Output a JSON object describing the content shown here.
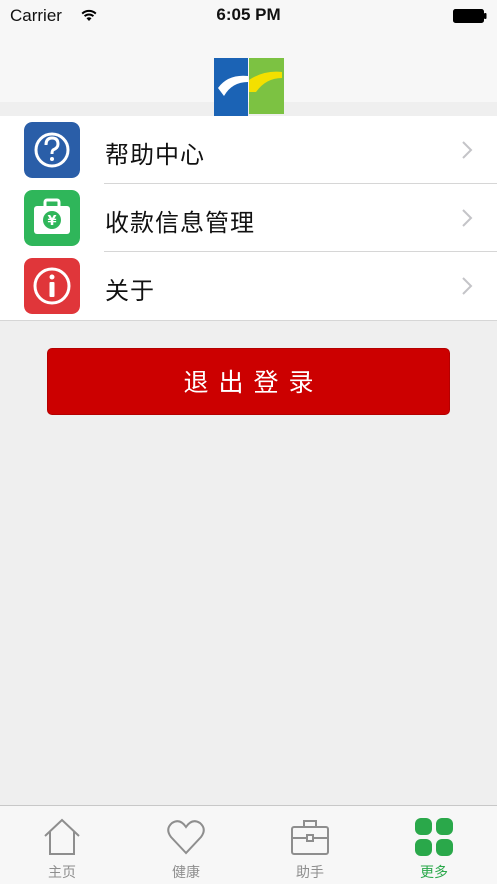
{
  "status_bar": {
    "carrier": "Carrier",
    "time": "6:05 PM"
  },
  "menu": {
    "items": [
      {
        "label": "帮助中心",
        "icon": "help-question-icon",
        "color": "#2a5ea8"
      },
      {
        "label": "收款信息管理",
        "icon": "wallet-yuan-icon",
        "color": "#2fb65a"
      },
      {
        "label": "关于",
        "icon": "info-icon",
        "color": "#e0363a"
      }
    ]
  },
  "logout": {
    "label": "退出登录",
    "color": "#cc0000"
  },
  "tab_bar": {
    "tabs": [
      {
        "label": "主页",
        "icon": "home-icon"
      },
      {
        "label": "健康",
        "icon": "heart-icon"
      },
      {
        "label": "助手",
        "icon": "briefcase-icon"
      },
      {
        "label": "更多",
        "icon": "grid-icon",
        "active": true
      }
    ],
    "active_color": "#2aa84a"
  }
}
